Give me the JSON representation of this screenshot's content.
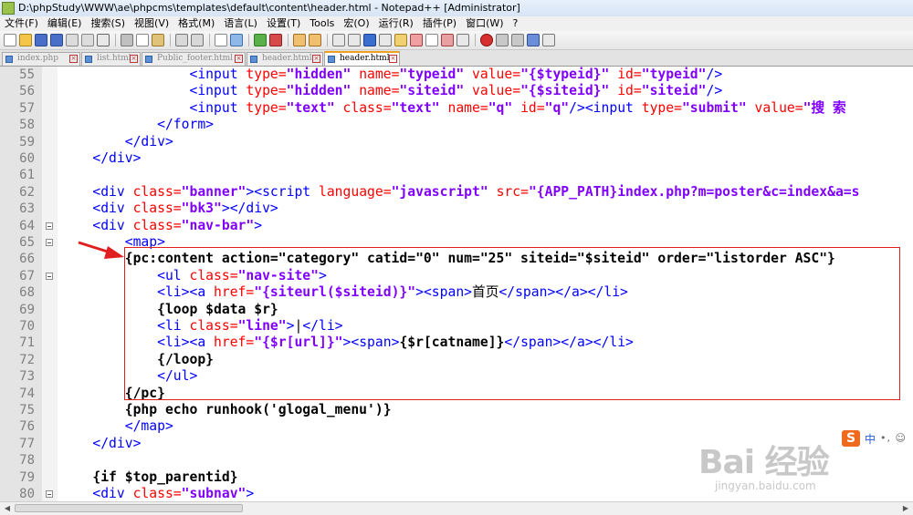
{
  "window": {
    "title": "D:\\phpStudy\\WWW\\ae\\phpcms\\templates\\default\\content\\header.html - Notepad++ [Administrator]"
  },
  "menu": [
    "文件(F)",
    "编辑(E)",
    "搜索(S)",
    "视图(V)",
    "格式(M)",
    "语言(L)",
    "设置(T)",
    "Tools",
    "宏(O)",
    "运行(R)",
    "插件(P)",
    "窗口(W)",
    "?"
  ],
  "tabs": [
    {
      "label": "index.php",
      "active": false
    },
    {
      "label": "list.html",
      "active": false
    },
    {
      "label": "Public_footer.html",
      "active": false
    },
    {
      "label": "header.html",
      "active": false
    },
    {
      "label": "header.html",
      "active": true
    }
  ],
  "colors": {
    "tag": "#0000ff",
    "attribute": "#ff0000",
    "string": "#8000ff",
    "highlight_box": "#e02020",
    "arrow": "#e02020"
  },
  "editor": {
    "lines": [
      {
        "n": "55",
        "fold": false,
        "tokens": [
          [
            "t",
            "                "
          ],
          [
            "g",
            "<input "
          ],
          [
            "a",
            "type="
          ],
          [
            "v",
            "\"hidden\""
          ],
          [
            "t",
            " "
          ],
          [
            "a",
            "name="
          ],
          [
            "v",
            "\"typeid\""
          ],
          [
            "t",
            " "
          ],
          [
            "a",
            "value="
          ],
          [
            "v",
            "\"{$typeid}\""
          ],
          [
            "t",
            " "
          ],
          [
            "a",
            "id="
          ],
          [
            "v",
            "\"typeid\""
          ],
          [
            "g",
            "/>"
          ]
        ]
      },
      {
        "n": "56",
        "fold": false,
        "tokens": [
          [
            "t",
            "                "
          ],
          [
            "g",
            "<input "
          ],
          [
            "a",
            "type="
          ],
          [
            "v",
            "\"hidden\""
          ],
          [
            "t",
            " "
          ],
          [
            "a",
            "name="
          ],
          [
            "v",
            "\"siteid\""
          ],
          [
            "t",
            " "
          ],
          [
            "a",
            "value="
          ],
          [
            "v",
            "\"{$siteid}\""
          ],
          [
            "t",
            " "
          ],
          [
            "a",
            "id="
          ],
          [
            "v",
            "\"siteid\""
          ],
          [
            "g",
            "/>"
          ]
        ]
      },
      {
        "n": "57",
        "fold": false,
        "tokens": [
          [
            "t",
            "                "
          ],
          [
            "g",
            "<input "
          ],
          [
            "a",
            "type="
          ],
          [
            "v",
            "\"text\""
          ],
          [
            "t",
            " "
          ],
          [
            "a",
            "class="
          ],
          [
            "v",
            "\"text\""
          ],
          [
            "t",
            " "
          ],
          [
            "a",
            "name="
          ],
          [
            "v",
            "\"q\""
          ],
          [
            "t",
            " "
          ],
          [
            "a",
            "id="
          ],
          [
            "v",
            "\"q\""
          ],
          [
            "g",
            "/><input "
          ],
          [
            "a",
            "type="
          ],
          [
            "v",
            "\"submit\""
          ],
          [
            "t",
            " "
          ],
          [
            "a",
            "value="
          ],
          [
            "v",
            "\"搜 索"
          ]
        ]
      },
      {
        "n": "58",
        "fold": false,
        "tokens": [
          [
            "t",
            "            "
          ],
          [
            "g",
            "</form>"
          ]
        ]
      },
      {
        "n": "59",
        "fold": false,
        "tokens": [
          [
            "t",
            "        "
          ],
          [
            "g",
            "</div>"
          ]
        ]
      },
      {
        "n": "60",
        "fold": false,
        "tokens": [
          [
            "t",
            "    "
          ],
          [
            "g",
            "</div>"
          ]
        ]
      },
      {
        "n": "61",
        "fold": false,
        "tokens": []
      },
      {
        "n": "62",
        "fold": false,
        "tokens": [
          [
            "t",
            "    "
          ],
          [
            "g",
            "<div "
          ],
          [
            "a",
            "class="
          ],
          [
            "v",
            "\"banner\""
          ],
          [
            "g",
            "><script "
          ],
          [
            "a",
            "language="
          ],
          [
            "v",
            "\"javascript\""
          ],
          [
            "t",
            " "
          ],
          [
            "a",
            "src="
          ],
          [
            "v",
            "\"{APP_PATH}index.php?m=poster&c=index&a=s"
          ]
        ]
      },
      {
        "n": "63",
        "fold": false,
        "tokens": [
          [
            "t",
            "    "
          ],
          [
            "g",
            "<div "
          ],
          [
            "a",
            "class="
          ],
          [
            "v",
            "\"bk3\""
          ],
          [
            "g",
            "></div>"
          ]
        ]
      },
      {
        "n": "64",
        "fold": true,
        "tokens": [
          [
            "t",
            "    "
          ],
          [
            "g",
            "<div "
          ],
          [
            "a",
            "class="
          ],
          [
            "v",
            "\"nav-bar\""
          ],
          [
            "g",
            ">"
          ]
        ]
      },
      {
        "n": "65",
        "fold": true,
        "tokens": [
          [
            "t",
            "        "
          ],
          [
            "g",
            "<map>"
          ]
        ]
      },
      {
        "n": "66",
        "fold": false,
        "tokens": [
          [
            "t",
            "        "
          ],
          [
            "p",
            "{pc:content action=\"category\" catid=\"0\" num=\"25\" siteid=\"$siteid\" order=\"listorder ASC\"}"
          ]
        ]
      },
      {
        "n": "67",
        "fold": true,
        "tokens": [
          [
            "t",
            "            "
          ],
          [
            "g",
            "<ul "
          ],
          [
            "a",
            "class="
          ],
          [
            "v",
            "\"nav-site\""
          ],
          [
            "g",
            ">"
          ]
        ]
      },
      {
        "n": "68",
        "fold": false,
        "tokens": [
          [
            "t",
            "            "
          ],
          [
            "g",
            "<li><a "
          ],
          [
            "a",
            "href="
          ],
          [
            "v",
            "\"{siteurl($siteid)}\""
          ],
          [
            "g",
            "><span>"
          ],
          [
            "t",
            "首页"
          ],
          [
            "g",
            "</span></a></li>"
          ]
        ]
      },
      {
        "n": "69",
        "fold": false,
        "tokens": [
          [
            "t",
            "            "
          ],
          [
            "p",
            "{loop $data $r}"
          ]
        ]
      },
      {
        "n": "70",
        "fold": false,
        "tokens": [
          [
            "t",
            "            "
          ],
          [
            "g",
            "<li "
          ],
          [
            "a",
            "class="
          ],
          [
            "v",
            "\"line\""
          ],
          [
            "g",
            ">"
          ],
          [
            "t",
            "|"
          ],
          [
            "g",
            "</li>"
          ]
        ]
      },
      {
        "n": "71",
        "fold": false,
        "tokens": [
          [
            "t",
            "            "
          ],
          [
            "g",
            "<li><a "
          ],
          [
            "a",
            "href="
          ],
          [
            "v",
            "\"{$r[url]}\""
          ],
          [
            "g",
            "><span>"
          ],
          [
            "p",
            "{$r[catname]}"
          ],
          [
            "g",
            "</span></a></li>"
          ]
        ]
      },
      {
        "n": "72",
        "fold": false,
        "tokens": [
          [
            "t",
            "            "
          ],
          [
            "p",
            "{/loop}"
          ]
        ]
      },
      {
        "n": "73",
        "fold": false,
        "tokens": [
          [
            "t",
            "            "
          ],
          [
            "g",
            "</ul>"
          ]
        ]
      },
      {
        "n": "74",
        "fold": false,
        "tokens": [
          [
            "t",
            "        "
          ],
          [
            "p",
            "{/pc}"
          ]
        ]
      },
      {
        "n": "75",
        "fold": false,
        "tokens": [
          [
            "t",
            "        "
          ],
          [
            "p",
            "{php echo runhook('glogal_menu')}"
          ]
        ]
      },
      {
        "n": "76",
        "fold": false,
        "tokens": [
          [
            "t",
            "        "
          ],
          [
            "g",
            "</map>"
          ]
        ]
      },
      {
        "n": "77",
        "fold": false,
        "tokens": [
          [
            "t",
            "    "
          ],
          [
            "g",
            "</div>"
          ]
        ]
      },
      {
        "n": "78",
        "fold": false,
        "tokens": []
      },
      {
        "n": "79",
        "fold": false,
        "tokens": [
          [
            "t",
            "    "
          ],
          [
            "p",
            "{if $top_parentid}"
          ]
        ]
      },
      {
        "n": "80",
        "fold": true,
        "tokens": [
          [
            "t",
            "    "
          ],
          [
            "g",
            "<div "
          ],
          [
            "a",
            "class="
          ],
          [
            "v",
            "\"subnav\""
          ],
          [
            "g",
            ">"
          ]
        ]
      }
    ]
  },
  "ime": {
    "logo": "S",
    "mode": "中",
    "extra": "•, ☺"
  },
  "watermark": {
    "brand": "Bai 经验",
    "sub": "jingyan.baidu.com"
  }
}
